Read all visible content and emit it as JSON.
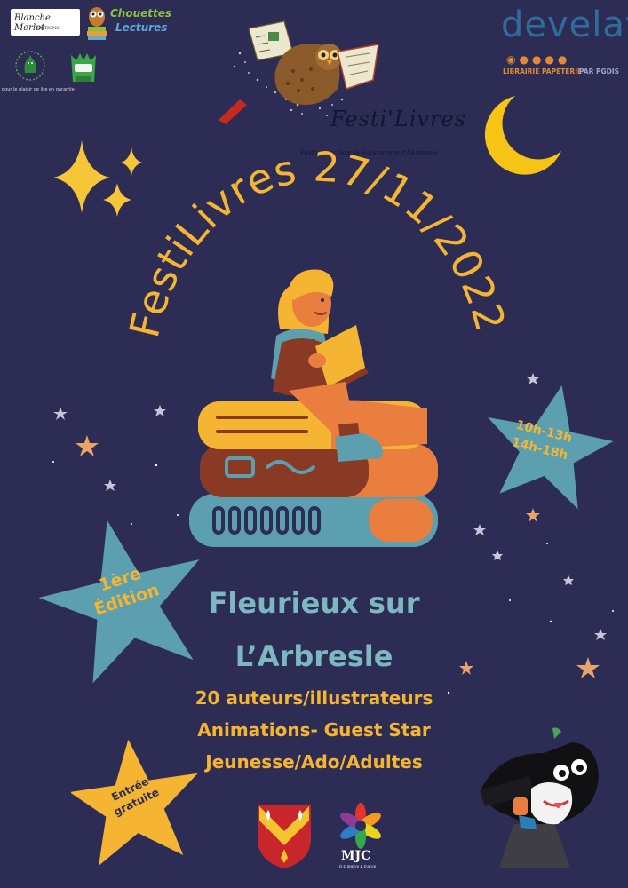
{
  "colors": {
    "background": "#2d2c55",
    "gold": "#f5b533",
    "teal": "#5c9fae",
    "orange": "#e97e3f",
    "brown": "#8a3a24"
  },
  "logos": {
    "publisher": "Blanche Merlot",
    "publisher_sub": "ÉDITIONS",
    "chouettes_line1": "Chouettes",
    "chouettes_line2": "Lectures",
    "green_left_caption": "pour le plaisir de lire en garantie",
    "develay_name": "develay",
    "develay_tagline": "LIBRAIRIE PAPETERIE",
    "develay_par": "PAR PGDIS",
    "festival_script": "Festi'Livres",
    "festival_sub": "Festival du livre de Fleurieux-sur-l'Arbresle",
    "mjc": "MJC",
    "mjc_sub": "FLEURIEUX & EVEUX"
  },
  "headline": "FestiLivres 27/11/2022",
  "hours": {
    "line1": "10h-13h",
    "line2": "14h-18h"
  },
  "edition": {
    "line1": "1ère",
    "line2": "Édition"
  },
  "location": {
    "line1": "Fleurieux sur",
    "line2": "L’Arbresle"
  },
  "details": {
    "line1": "20 auteurs/illustrateurs",
    "line2": "Animations- Guest Star",
    "line3": "Jeunesse/Ado/Adultes"
  },
  "entry": {
    "line1": "Entrée",
    "line2": "gratuite"
  }
}
